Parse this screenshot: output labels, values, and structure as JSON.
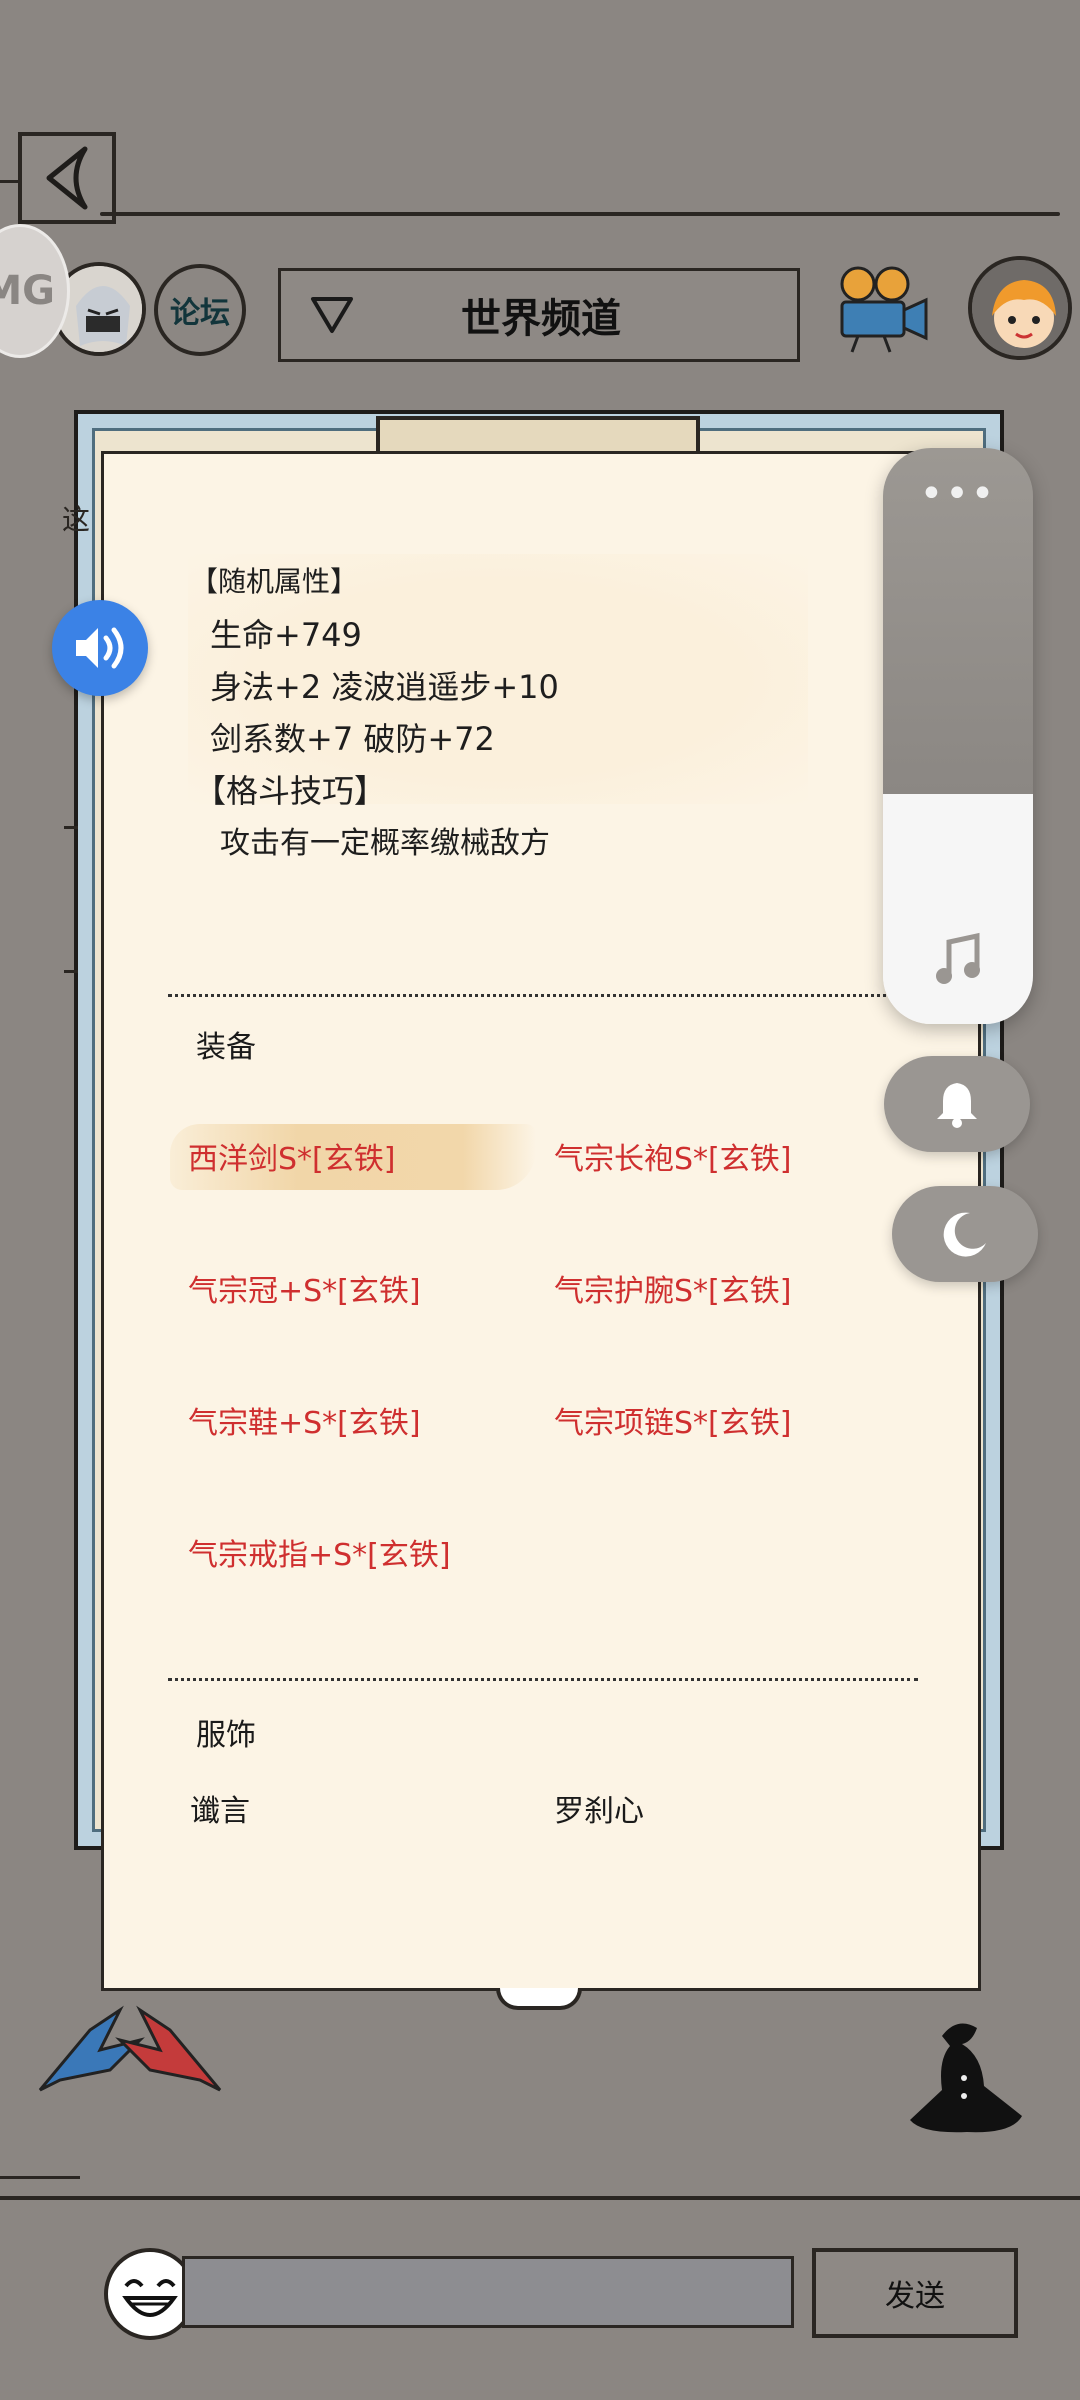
{
  "header": {
    "forum_label": "论坛",
    "channel_label": "世界频道",
    "mg_badge": "MG"
  },
  "attributes": {
    "random_title": "【随机属性】",
    "lines": [
      "生命+749",
      "身法+2 凌波逍遥步+10",
      "剑系数+7 破防+72"
    ],
    "skill_title": "【格斗技巧】",
    "skill_desc": "攻击有一定概率缴械敌方"
  },
  "equipment": {
    "title": "装备",
    "items": [
      "西洋剑S*[玄铁]",
      "气宗长袍S*[玄铁]",
      "气宗冠+S*[玄铁]",
      "气宗护腕S*[玄铁]",
      "气宗鞋+S*[玄铁]",
      "气宗项链S*[玄铁]",
      "气宗戒指+S*[玄铁]"
    ],
    "item_color": "#cf2f2f"
  },
  "costume": {
    "title": "服饰",
    "items": [
      "谶言",
      "罗刹心"
    ]
  },
  "chat": {
    "input_value": "",
    "send_label": "发送"
  },
  "overlay": {
    "volume_level": 0.4,
    "sound_icon": "speaker-icon",
    "panel_icons": [
      "more-icon",
      "music-note-icon",
      "bell-icon",
      "moon-icon"
    ],
    "accent": "#3b82e6"
  }
}
